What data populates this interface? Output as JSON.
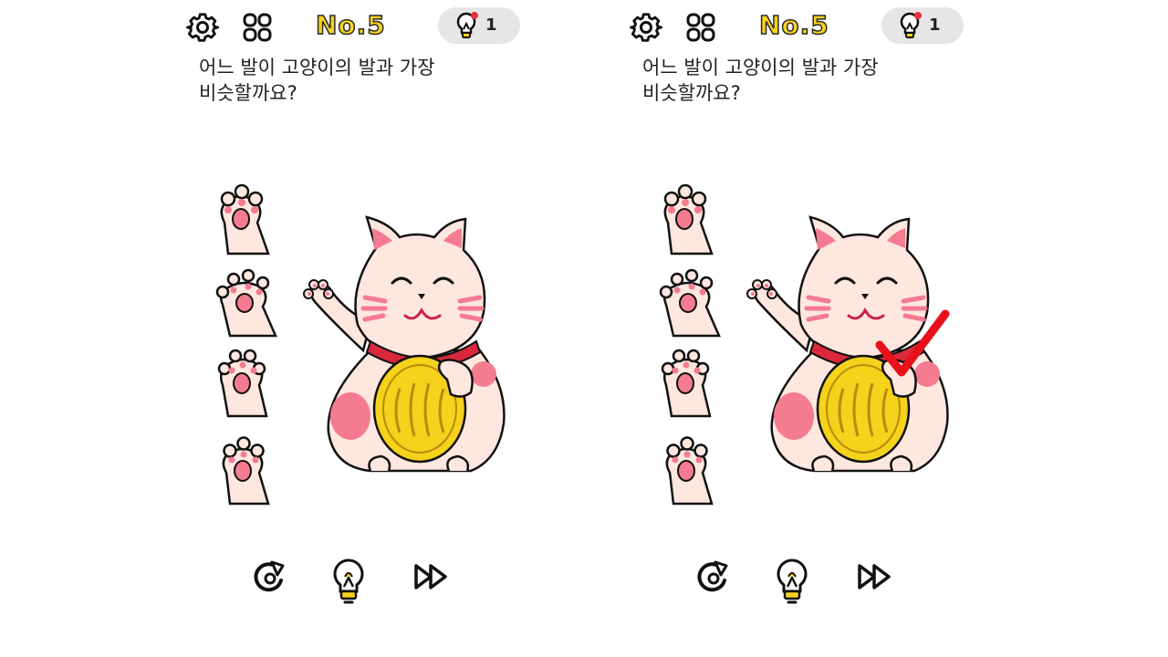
{
  "panels": [
    {
      "level": "No.5",
      "hint_count": "1",
      "question": [
        "어느 발이 고양이의 발과 가장",
        "비슷할까요?"
      ],
      "paws": [
        {
          "id": "A",
          "variant": "three-toes"
        },
        {
          "id": "B",
          "variant": "four-toes"
        },
        {
          "id": "C",
          "variant": "four-toes-rounded"
        },
        {
          "id": "D",
          "variant": "three-toes-thin"
        }
      ],
      "checkmark_visible": false
    },
    {
      "level": "No.5",
      "hint_count": "1",
      "question": [
        "어느 발이 고양이의 발과 가장",
        "비슷할까요?"
      ],
      "paws": [
        {
          "id": "A",
          "variant": "three-toes"
        },
        {
          "id": "B",
          "variant": "four-toes"
        },
        {
          "id": "C",
          "variant": "four-toes-rounded"
        },
        {
          "id": "D",
          "variant": "three-toes-thin"
        }
      ],
      "checkmark_visible": true
    }
  ],
  "icons": {
    "settings": "gear-icon",
    "menu": "grid-icon",
    "hint_counter": "lightbulb-icon",
    "restart": "restart-icon",
    "hint": "lightbulb-icon",
    "skip": "fast-forward-icon",
    "checkmark": "checkmark-icon"
  },
  "colors": {
    "level_text": "#f7d21e",
    "cat_body": "#fde7df",
    "cat_pink": "#f57b90",
    "coin": "#f5d21b",
    "collar": "#d9283c",
    "checkmark": "#e8101a",
    "hint_bg": "#e6e6e6"
  }
}
